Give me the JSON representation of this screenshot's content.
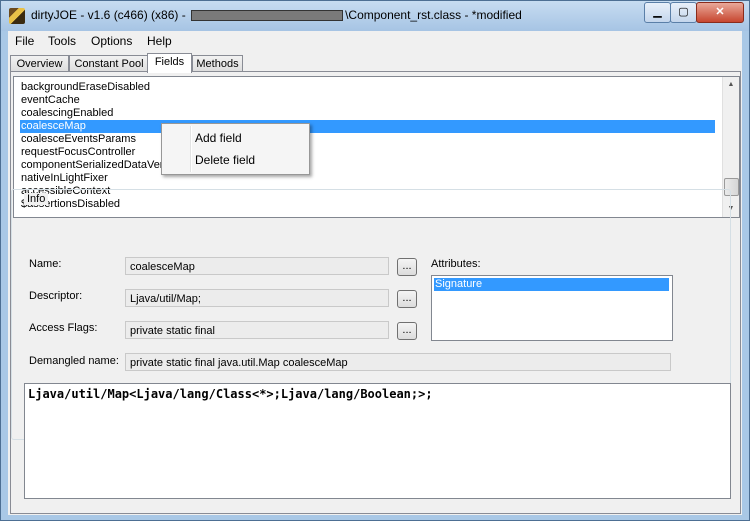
{
  "window": {
    "title_prefix": "dirtyJOE - v1.6 (c466) (x86) -",
    "title_suffix": "\\Component_rst.class - *modified",
    "minimize": "▁",
    "maximize": "▢",
    "close": "✕"
  },
  "menu": [
    "File",
    "Tools",
    "Options",
    "Help"
  ],
  "tabs": [
    "Overview",
    "Constant Pool",
    "Fields",
    "Methods"
  ],
  "active_tab": "Fields",
  "fields_list": [
    "backgroundEraseDisabled",
    "eventCache",
    "coalescingEnabled",
    "coalesceMap",
    "coalesceEventsParams",
    "requestFocusController",
    "componentSerializedDataVers",
    "nativeInLightFixer",
    "accessibleContext",
    "$assertionsDisabled"
  ],
  "selected_field": "coalesceMap",
  "context_menu": [
    "Add field",
    "Delete field"
  ],
  "info": {
    "group_label": "Info",
    "name_label": "Name:",
    "name_value": "coalesceMap",
    "descriptor_label": "Descriptor:",
    "descriptor_value": "Ljava/util/Map;",
    "access_label": "Access Flags:",
    "access_value": "private static final",
    "demangled_label": "Demangled name:",
    "demangled_value": "private static final java.util.Map coalesceMap",
    "attributes_label": "Attributes:",
    "attributes": [
      "Signature"
    ],
    "browse_label": "..."
  },
  "editor_text": "Ljava/util/Map<Ljava/lang/Class<*>;Ljava/lang/Boolean;>;",
  "colors": {
    "selection": "#3399ff",
    "titlebar": "#a9c8e6",
    "close_button": "#c7462f"
  }
}
